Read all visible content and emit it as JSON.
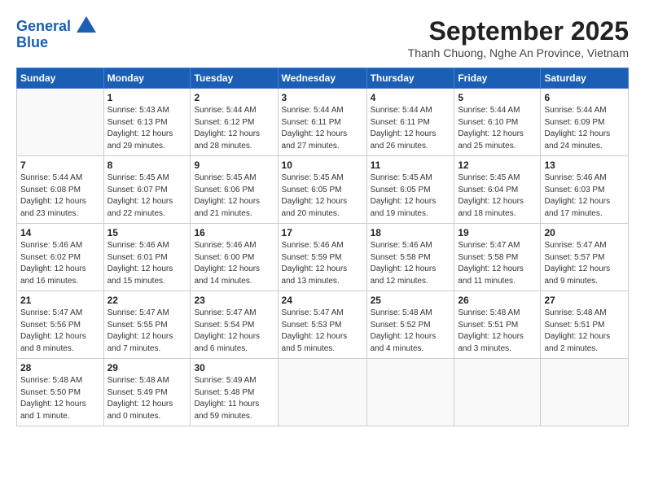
{
  "header": {
    "logo_line1": "General",
    "logo_line2": "Blue",
    "month_title": "September 2025",
    "location": "Thanh Chuong, Nghe An Province, Vietnam"
  },
  "days_of_week": [
    "Sunday",
    "Monday",
    "Tuesday",
    "Wednesday",
    "Thursday",
    "Friday",
    "Saturday"
  ],
  "weeks": [
    [
      {
        "day": "",
        "info": ""
      },
      {
        "day": "1",
        "info": "Sunrise: 5:43 AM\nSunset: 6:13 PM\nDaylight: 12 hours\nand 29 minutes."
      },
      {
        "day": "2",
        "info": "Sunrise: 5:44 AM\nSunset: 6:12 PM\nDaylight: 12 hours\nand 28 minutes."
      },
      {
        "day": "3",
        "info": "Sunrise: 5:44 AM\nSunset: 6:11 PM\nDaylight: 12 hours\nand 27 minutes."
      },
      {
        "day": "4",
        "info": "Sunrise: 5:44 AM\nSunset: 6:11 PM\nDaylight: 12 hours\nand 26 minutes."
      },
      {
        "day": "5",
        "info": "Sunrise: 5:44 AM\nSunset: 6:10 PM\nDaylight: 12 hours\nand 25 minutes."
      },
      {
        "day": "6",
        "info": "Sunrise: 5:44 AM\nSunset: 6:09 PM\nDaylight: 12 hours\nand 24 minutes."
      }
    ],
    [
      {
        "day": "7",
        "info": "Sunrise: 5:44 AM\nSunset: 6:08 PM\nDaylight: 12 hours\nand 23 minutes."
      },
      {
        "day": "8",
        "info": "Sunrise: 5:45 AM\nSunset: 6:07 PM\nDaylight: 12 hours\nand 22 minutes."
      },
      {
        "day": "9",
        "info": "Sunrise: 5:45 AM\nSunset: 6:06 PM\nDaylight: 12 hours\nand 21 minutes."
      },
      {
        "day": "10",
        "info": "Sunrise: 5:45 AM\nSunset: 6:05 PM\nDaylight: 12 hours\nand 20 minutes."
      },
      {
        "day": "11",
        "info": "Sunrise: 5:45 AM\nSunset: 6:05 PM\nDaylight: 12 hours\nand 19 minutes."
      },
      {
        "day": "12",
        "info": "Sunrise: 5:45 AM\nSunset: 6:04 PM\nDaylight: 12 hours\nand 18 minutes."
      },
      {
        "day": "13",
        "info": "Sunrise: 5:46 AM\nSunset: 6:03 PM\nDaylight: 12 hours\nand 17 minutes."
      }
    ],
    [
      {
        "day": "14",
        "info": "Sunrise: 5:46 AM\nSunset: 6:02 PM\nDaylight: 12 hours\nand 16 minutes."
      },
      {
        "day": "15",
        "info": "Sunrise: 5:46 AM\nSunset: 6:01 PM\nDaylight: 12 hours\nand 15 minutes."
      },
      {
        "day": "16",
        "info": "Sunrise: 5:46 AM\nSunset: 6:00 PM\nDaylight: 12 hours\nand 14 minutes."
      },
      {
        "day": "17",
        "info": "Sunrise: 5:46 AM\nSunset: 5:59 PM\nDaylight: 12 hours\nand 13 minutes."
      },
      {
        "day": "18",
        "info": "Sunrise: 5:46 AM\nSunset: 5:58 PM\nDaylight: 12 hours\nand 12 minutes."
      },
      {
        "day": "19",
        "info": "Sunrise: 5:47 AM\nSunset: 5:58 PM\nDaylight: 12 hours\nand 11 minutes."
      },
      {
        "day": "20",
        "info": "Sunrise: 5:47 AM\nSunset: 5:57 PM\nDaylight: 12 hours\nand 9 minutes."
      }
    ],
    [
      {
        "day": "21",
        "info": "Sunrise: 5:47 AM\nSunset: 5:56 PM\nDaylight: 12 hours\nand 8 minutes."
      },
      {
        "day": "22",
        "info": "Sunrise: 5:47 AM\nSunset: 5:55 PM\nDaylight: 12 hours\nand 7 minutes."
      },
      {
        "day": "23",
        "info": "Sunrise: 5:47 AM\nSunset: 5:54 PM\nDaylight: 12 hours\nand 6 minutes."
      },
      {
        "day": "24",
        "info": "Sunrise: 5:47 AM\nSunset: 5:53 PM\nDaylight: 12 hours\nand 5 minutes."
      },
      {
        "day": "25",
        "info": "Sunrise: 5:48 AM\nSunset: 5:52 PM\nDaylight: 12 hours\nand 4 minutes."
      },
      {
        "day": "26",
        "info": "Sunrise: 5:48 AM\nSunset: 5:51 PM\nDaylight: 12 hours\nand 3 minutes."
      },
      {
        "day": "27",
        "info": "Sunrise: 5:48 AM\nSunset: 5:51 PM\nDaylight: 12 hours\nand 2 minutes."
      }
    ],
    [
      {
        "day": "28",
        "info": "Sunrise: 5:48 AM\nSunset: 5:50 PM\nDaylight: 12 hours\nand 1 minute."
      },
      {
        "day": "29",
        "info": "Sunrise: 5:48 AM\nSunset: 5:49 PM\nDaylight: 12 hours\nand 0 minutes."
      },
      {
        "day": "30",
        "info": "Sunrise: 5:49 AM\nSunset: 5:48 PM\nDaylight: 11 hours\nand 59 minutes."
      },
      {
        "day": "",
        "info": ""
      },
      {
        "day": "",
        "info": ""
      },
      {
        "day": "",
        "info": ""
      },
      {
        "day": "",
        "info": ""
      }
    ]
  ]
}
